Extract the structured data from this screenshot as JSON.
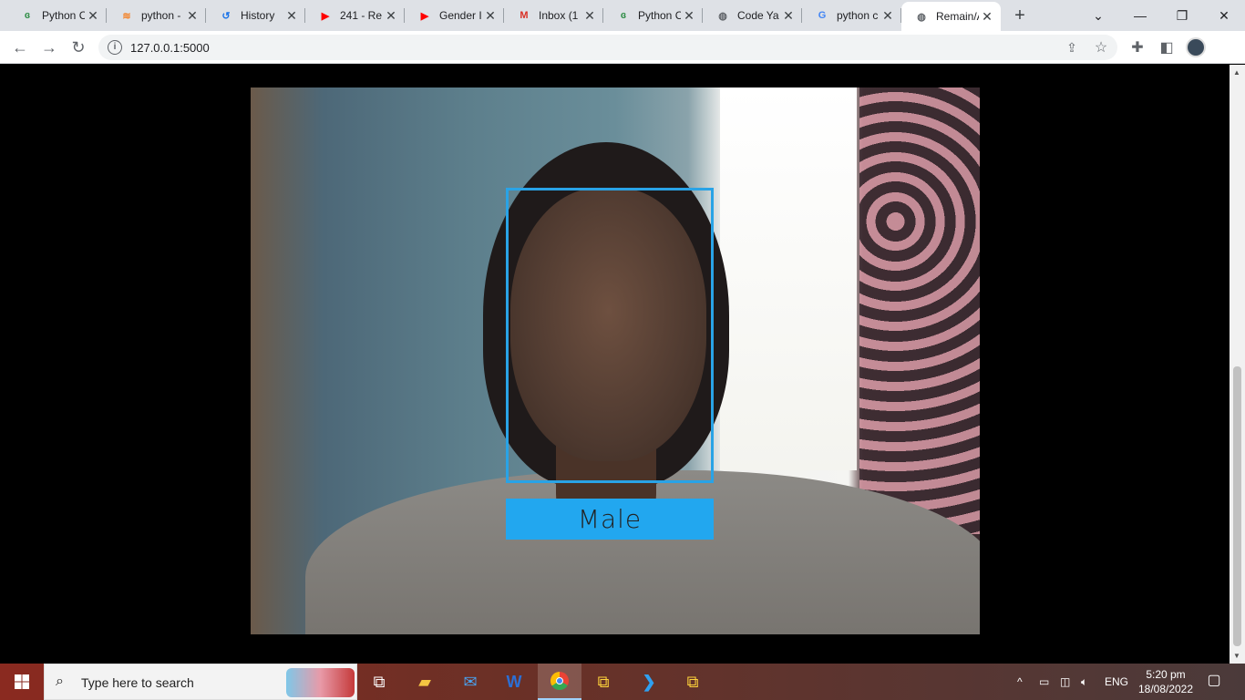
{
  "browser": {
    "tabs": [
      {
        "label": "Python C",
        "icon": "gfg-icon",
        "glyph": "ɞ",
        "color": "#2f8d46"
      },
      {
        "label": "python -",
        "icon": "stackoverflow-icon",
        "glyph": "≋",
        "color": "#f48024"
      },
      {
        "label": "History",
        "icon": "history-icon",
        "glyph": "↺",
        "color": "#1a73e8"
      },
      {
        "label": "241 - Re",
        "icon": "youtube-icon",
        "glyph": "▶",
        "color": "#ff0000"
      },
      {
        "label": "Gender I",
        "icon": "youtube-icon",
        "glyph": "▶",
        "color": "#ff0000"
      },
      {
        "label": "Inbox (1",
        "icon": "gmail-icon",
        "glyph": "M",
        "color": "#d93025"
      },
      {
        "label": "Python C",
        "icon": "gfg-icon",
        "glyph": "ɞ",
        "color": "#2f8d46"
      },
      {
        "label": "Code Ya",
        "icon": "globe-icon",
        "glyph": "◍",
        "color": "#5f6368"
      },
      {
        "label": "python c",
        "icon": "google-icon",
        "glyph": "G",
        "color": "#4285f4"
      },
      {
        "label": "Remain/A",
        "icon": "globe-icon",
        "glyph": "◍",
        "color": "#5f6368",
        "active": true
      }
    ],
    "new_tab": "+",
    "url": "127.0.0.1:5000"
  },
  "video": {
    "prediction_label": "Male",
    "box_color": "#29a3e6",
    "label_bg": "#22a7ef"
  },
  "taskbar": {
    "search_placeholder": "Type here to search",
    "language": "ENG",
    "time": "5:20 pm",
    "date": "18/08/2022"
  }
}
